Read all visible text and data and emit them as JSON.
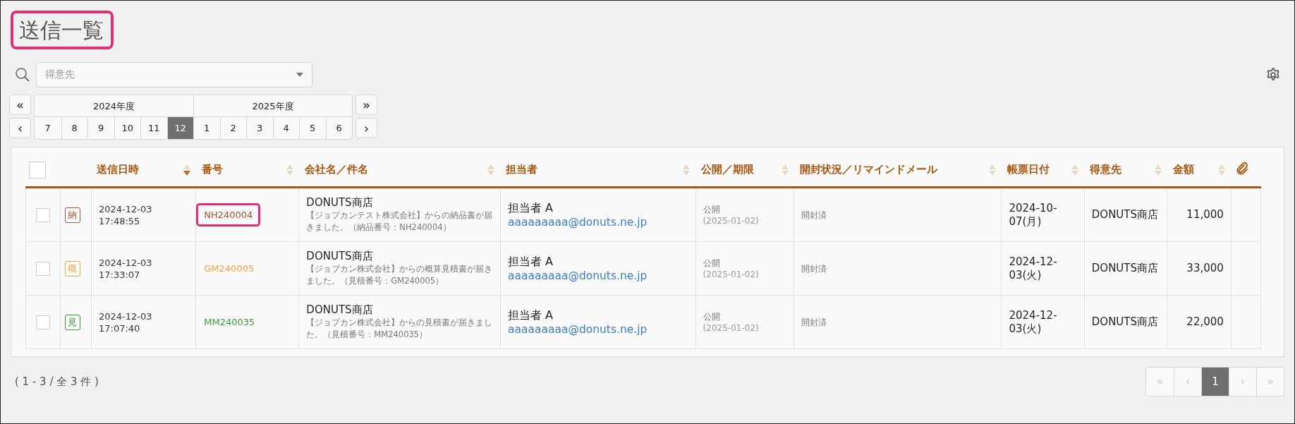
{
  "page": {
    "title": "送信一覧",
    "title_highlighted": true
  },
  "filter": {
    "placeholder": "得意先"
  },
  "period": {
    "years": [
      "2024年度",
      "2025年度"
    ],
    "months": [
      {
        "label": "7",
        "selected": false
      },
      {
        "label": "8",
        "selected": false
      },
      {
        "label": "9",
        "selected": false
      },
      {
        "label": "10",
        "selected": false
      },
      {
        "label": "11",
        "selected": false
      },
      {
        "label": "12",
        "selected": true
      },
      {
        "label": "1",
        "selected": false
      },
      {
        "label": "2",
        "selected": false
      },
      {
        "label": "3",
        "selected": false
      },
      {
        "label": "4",
        "selected": false
      },
      {
        "label": "5",
        "selected": false
      },
      {
        "label": "6",
        "selected": false
      }
    ],
    "first": "«",
    "prev": "‹",
    "next": "›",
    "last": "»"
  },
  "table": {
    "all_checked": false,
    "columns": [
      {
        "label": "送信日時",
        "sorted_desc": true
      },
      {
        "label": "番号",
        "sorted_desc": false
      },
      {
        "label": "会社名／件名",
        "sorted_desc": false
      },
      {
        "label": "担当者",
        "sorted_desc": false
      },
      {
        "label": "公開／期限",
        "sorted_desc": false
      },
      {
        "label": "開封状況／リマインドメール",
        "sorted_desc": false
      },
      {
        "label": "帳票日付",
        "sorted_desc": false
      },
      {
        "label": "得意先",
        "sorted_desc": false
      },
      {
        "label": "金額",
        "sorted_desc": false
      }
    ],
    "rows": [
      {
        "checked": false,
        "type": "納",
        "color": "#a0522d",
        "sent": "2024-12-03\n17:48:55",
        "number": "NH240004",
        "highlighted": true,
        "company": "DONUTS商店",
        "subject": "【ジョブカンテスト株式会社】からの納品書が届きました。（納品番号：NH240004）",
        "person": "担当者 A",
        "email": "aaaaaaaaa@donuts.ne.jp",
        "public": "公開",
        "deadline": "(2025-01-02)",
        "opened": "開封済",
        "doc_date": "2024-10-07(月)",
        "customer": "DONUTS商店",
        "amount": "11,000"
      },
      {
        "checked": false,
        "type": "概",
        "color": "#f0a040",
        "sent": "2024-12-03\n17:33:07",
        "number": "GM240005",
        "highlighted": false,
        "company": "DONUTS商店",
        "subject": "【ジョブカン株式会社】からの概算見積書が届きました。（見積番号：GM240005）",
        "person": "担当者 A",
        "email": "aaaaaaaaa@donuts.ne.jp",
        "public": "公開",
        "deadline": "(2025-01-02)",
        "opened": "開封済",
        "doc_date": "2024-12-03(火)",
        "customer": "DONUTS商店",
        "amount": "33,000"
      },
      {
        "checked": false,
        "type": "見",
        "color": "#3a9a3a",
        "sent": "2024-12-03\n17:07:40",
        "number": "MM240035",
        "highlighted": false,
        "company": "DONUTS商店",
        "subject": "【ジョブカン株式会社】からの見積書が届きました。（見積番号：MM240035）",
        "person": "担当者 A",
        "email": "aaaaaaaaa@donuts.ne.jp",
        "public": "公開",
        "deadline": "(2025-01-02)",
        "opened": "開封済",
        "doc_date": "2024-12-03(火)",
        "customer": "DONUTS商店",
        "amount": "22,000"
      }
    ]
  },
  "footer": {
    "count": "( 1 - 3 / 全 3 件 )",
    "pager": [
      {
        "label": "«",
        "selected": false,
        "disabled": true
      },
      {
        "label": "‹",
        "selected": false,
        "disabled": true
      },
      {
        "label": "1",
        "selected": true,
        "disabled": false
      },
      {
        "label": "›",
        "selected": false,
        "disabled": true
      },
      {
        "label": "»",
        "selected": false,
        "disabled": true
      }
    ]
  }
}
